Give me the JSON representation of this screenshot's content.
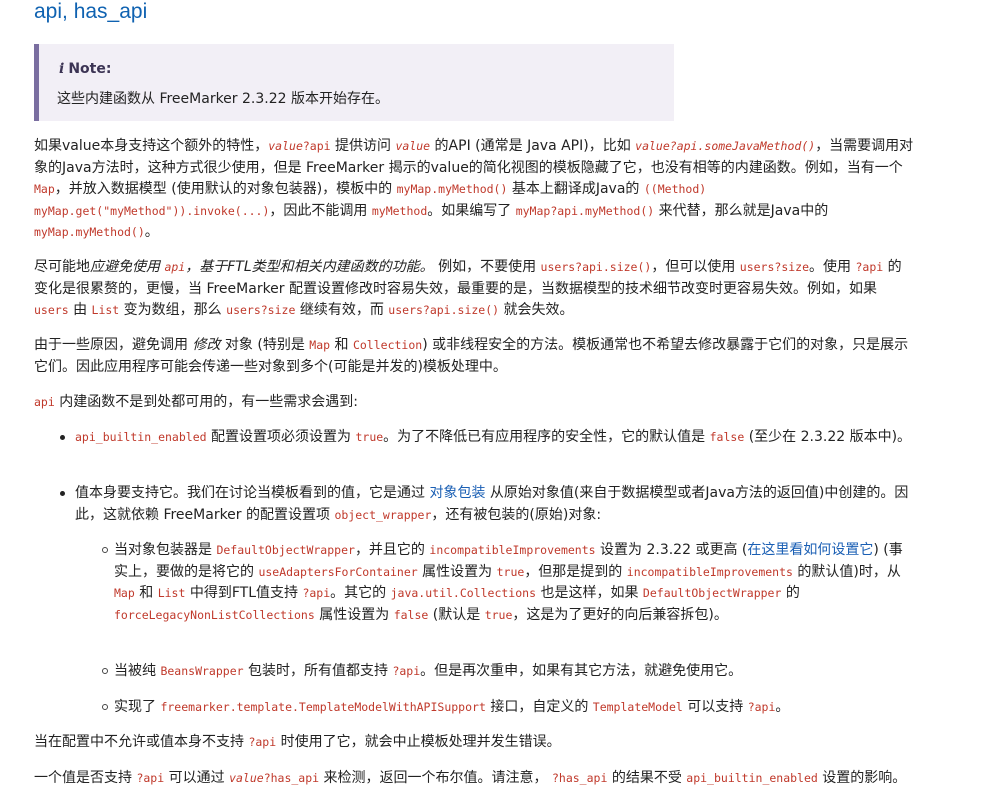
{
  "title": "api, has_api",
  "note": {
    "icon": "info-icon",
    "heading": "Note:",
    "body": "这些内建函数从 FreeMarker 2.3.22 版本开始存在。"
  },
  "p1": {
    "t1": "如果value本身支持这个额外的特性，",
    "c1": "value",
    "c1b": "?api",
    "t2": " 提供访问 ",
    "c2": "value",
    "t3": " 的API (通常是 Java API)，比如 ",
    "c3": "value",
    "c3b": "?api.someJavaMethod()",
    "t4": "，当需要调用对象的Java方法时，这种方式很少使用，但是 FreeMarker 揭示的value的简化视图的模板隐藏了它，也没有相等的内建函数。例如，当有一个 ",
    "c4": "Map",
    "t5": "，并放入数据模型 (使用默认的对象包装器)，模板中的 ",
    "c5": "myMap.myMethod()",
    "t6": " 基本上翻译成Java的 ",
    "c6": "((Method) myMap.get(\"myMethod\")).invoke(...)",
    "t7": "，因此不能调用 ",
    "c7": "myMethod",
    "t8": "。如果编写了 ",
    "c8": "myMap?api.myMethod()",
    "t9": " 来代替，那么就是Java中的 ",
    "c9": "myMap.myMethod()",
    "t10": "。"
  },
  "p2": {
    "t1": "尽可能地",
    "e1": "应避免使用 ",
    "c1": "api",
    "e2": "，基于FTL类型和相关内建函数的功能。",
    "t2": " 例如，不要使用 ",
    "c2": "users?api.size()",
    "t3": "，但可以使用 ",
    "c3": "users?size",
    "t4": "。使用 ",
    "c4": "?api",
    "t5": " 的变化是很累赘的，更慢，当 FreeMarker 配置设置修改时容易失效，最重要的是，当数据模型的技术细节改变时更容易失效。例如，如果 ",
    "c5": "users",
    "t6": " 由 ",
    "c6": "List",
    "t7": " 变为数组，那么 ",
    "c7": "users?size",
    "t8": " 继续有效，而 ",
    "c8": "users?api.size()",
    "t9": " 就会失效。"
  },
  "p3": {
    "t1": "由于一些原因，避免调用 ",
    "e1": "修改",
    "t2": " 对象 (特别是 ",
    "c1": "Map",
    "t3": " 和 ",
    "c2": "Collection",
    "t4": ") 或非线程安全的方法。模板通常也不希望去修改暴露于它们的对象，只是展示它们。因此应用程序可能会传递一些对象到多个(可能是并发的)模板处理中。"
  },
  "p4": {
    "c1": "api",
    "t1": " 内建函数不是到处都可用的，有一些需求会遇到:"
  },
  "li1": {
    "c1": "api_builtin_enabled",
    "t1": " 配置设置项必须设置为 ",
    "c2": "true",
    "t2": "。为了不降低已有应用程序的安全性，它的默认值是 ",
    "c3": "false",
    "t3": " (至少在 2.3.22 版本中)。"
  },
  "li2": {
    "t1": "值本身要支持它。我们在讨论当模板看到的值，它是通过 ",
    "a1": "对象包装",
    "t2": " 从原始对象值(来自于数据模型或者Java方法的返回值)中创建的。因此，这就依赖 FreeMarker 的配置设置项 ",
    "c1": "object_wrapper",
    "t3": "，还有被包装的(原始)对象:"
  },
  "li2a": {
    "t1": "当对象包装器是 ",
    "c1": "DefaultObjectWrapper",
    "t2": "，并且它的 ",
    "c2": "incompatibleImprovements",
    "t3": " 设置为 2.3.22 或更高 (",
    "a1": "在这里看如何设置它",
    "t4": ") (事实上，要做的是将它的 ",
    "c3": "useAdaptersForContainer",
    "t5": " 属性设置为 ",
    "c4": "true",
    "t6": "，但那是提到的 ",
    "c5": "incompatibleImprovements",
    "t7": " 的默认值)时，从 ",
    "c6": "Map",
    "t8": " 和 ",
    "c7": "List",
    "t9": " 中得到FTL值支持 ",
    "c8": "?api",
    "t10": "。其它的 ",
    "c9": "java.util.Collections",
    "t11": " 也是这样，如果 ",
    "c10": "DefaultObjectWrapper",
    "t12": " 的 ",
    "c11": "forceLegacyNonListCollections",
    "t13": " 属性设置为 ",
    "c12": "false",
    "t14": " (默认是 ",
    "c13": "true",
    "t15": "，这是为了更好的向后兼容拆包)。"
  },
  "li2b": {
    "t1": "当被纯 ",
    "c1": "BeansWrapper",
    "t2": " 包装时，所有值都支持 ",
    "c2": "?api",
    "t3": "。但是再次重申，如果有其它方法，就避免使用它。"
  },
  "li2c": {
    "t1": "实现了 ",
    "c1": "freemarker.template.TemplateModelWithAPISupport",
    "t2": " 接口，自定义的 ",
    "c2": "TemplateModel",
    "t3": " 可以支持 ",
    "c3": "?api",
    "t4": "。"
  },
  "p5": {
    "t1": "当在配置中不允许或值本身不支持 ",
    "c1": "?api",
    "t2": " 时使用了它，就会中止模板处理并发生错误。"
  },
  "p6": {
    "t1": "一个值是否支持 ",
    "c1": "?api",
    "t2": " 可以通过 ",
    "c2": "value",
    "c2b": "?has_api",
    "t3": " 来检测，返回一个布尔值。请注意， ",
    "c3": "?has_api",
    "t4": " 的结果不受 ",
    "c4": "api_builtin_enabled",
    "t5": " 设置的影响。"
  }
}
